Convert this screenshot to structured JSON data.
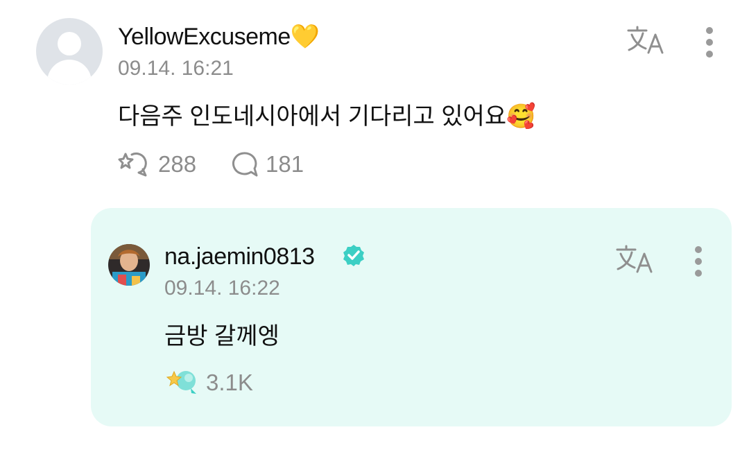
{
  "comment": {
    "username": "YellowExcuseme💛",
    "timestamp": "09.14. 16:21",
    "text": "다음주 인도네시아에서 기다리고 있어요🥰",
    "like_count": "288",
    "reply_count": "181",
    "translate_icon": "translate-icon",
    "more_icon": "more-vertical-icon",
    "like_icon": "sparkle-bubble-icon",
    "reply_icon": "comment-bubble-icon"
  },
  "reply": {
    "username": "na.jaemin0813",
    "verified_icon": "verified-badge-icon",
    "timestamp": "09.14. 16:22",
    "text": "금방 갈께엥",
    "like_count": "3.1K",
    "translate_icon": "translate-icon",
    "more_icon": "more-vertical-icon",
    "like_icon": "sparkle-bubble-filled-icon"
  },
  "colors": {
    "reply_bg": "#e6faf6",
    "accent": "#3ccfc4",
    "muted": "#8c8c8c"
  }
}
